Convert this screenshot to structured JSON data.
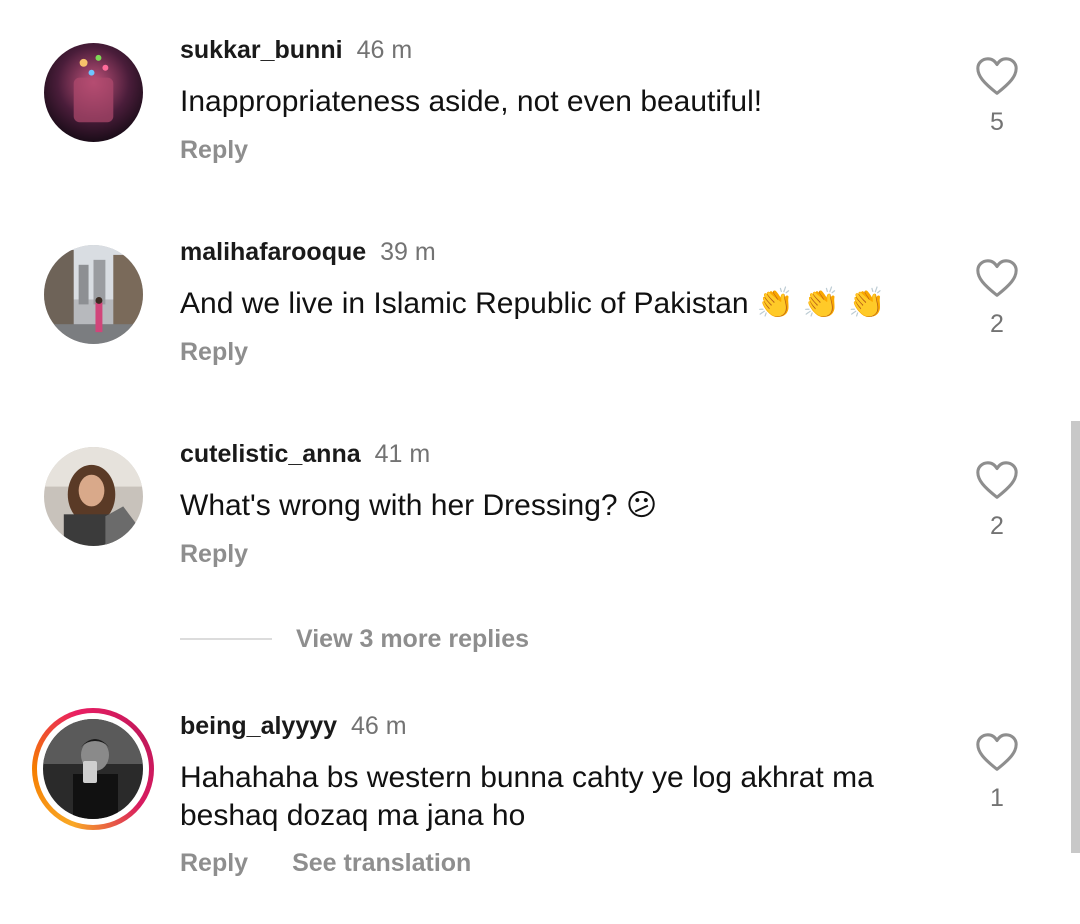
{
  "comments": [
    {
      "username": "sukkar_bunni",
      "time": "46 m",
      "text": "Inappropriateness aside, not even beautiful!",
      "reply_label": "Reply",
      "likes": "5"
    },
    {
      "username": "malihafarooque",
      "time": "39 m",
      "text": "And we live in Islamic Republic of Pakistan 👏 👏 👏",
      "reply_label": "Reply",
      "likes": "2"
    },
    {
      "username": "cutelistic_anna",
      "time": "41 m",
      "text": "What's wrong with her Dressing? 😕",
      "reply_label": "Reply",
      "likes": "2"
    },
    {
      "username": "being_alyyyy",
      "time": "46 m",
      "text": "Hahahaha bs western bunna cahty ye log akhrat ma beshaq dozaq ma jana ho",
      "reply_label": "Reply",
      "translate_label": "See translation",
      "likes": "1"
    }
  ],
  "view_more_replies": "View 3 more replies",
  "icons": {
    "like": "heart-outline-icon"
  },
  "colors": {
    "username": "#1a1a1a",
    "muted": "#8e8e8e",
    "story_ring": [
      "#f9a825",
      "#e91e63"
    ]
  }
}
